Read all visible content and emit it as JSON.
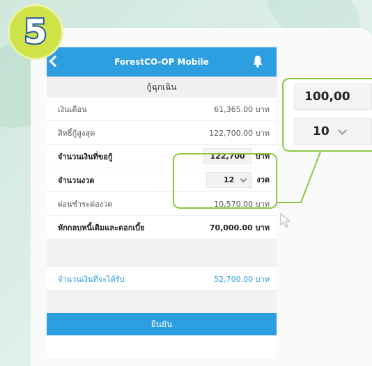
{
  "step_badge": "5",
  "app": {
    "title": "ForestCO-OP Mobile",
    "page_title": "กู้ฉุกเฉิน"
  },
  "rows": {
    "salary": {
      "label": "เงินเดือน",
      "value": "61,365.00 บาท"
    },
    "max_loan": {
      "label": "สิทธิ์กู้สูงสุด",
      "value": "122,700.00 บาท"
    },
    "loan_amount": {
      "label": "จำนวนเงินที่ขอกู้",
      "value": "122,700",
      "unit": "บาท"
    },
    "installments": {
      "label": "จำนวนงวด",
      "value": "12",
      "unit": "งวด"
    },
    "monthly_payment": {
      "label": "ผ่อนชำระต่องวด",
      "value": "10,570.00 บาท"
    },
    "deduction": {
      "label": "หักกลบหนี้เดิมและดอกเบี้ย",
      "value": "70,000.00 บาท"
    },
    "receive": {
      "label": "จำนวนเงินที่จะได้รับ",
      "value": "52,700.00 บาท"
    }
  },
  "confirm_label": "ยืนยัน",
  "zoom": {
    "amount": "100,00",
    "installments": "10"
  },
  "colors": {
    "header_blue": "#2d9ee0",
    "highlight_green": "#8cc63f",
    "badge_yellow": "#cfe247",
    "badge_outline": "#1f5aa6"
  },
  "icons": [
    "back-arrow-icon",
    "bell-icon",
    "chevron-down-icon",
    "cursor-icon"
  ]
}
